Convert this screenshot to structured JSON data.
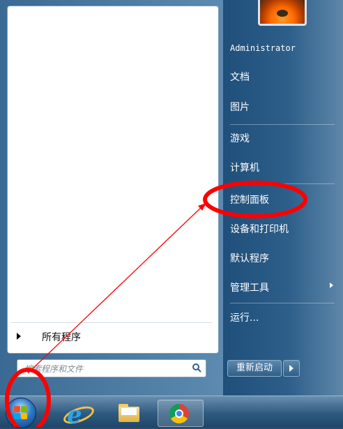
{
  "user": {
    "name": "Administrator"
  },
  "right_menu": {
    "documents": "文档",
    "pictures": "图片",
    "games": "游戏",
    "computer": "计算机",
    "control_panel": "控制面板",
    "devices_printers": "设备和打印机",
    "default_programs": "默认程序",
    "admin_tools": "管理工具",
    "run": "运行..."
  },
  "left_menu": {
    "all_programs": "所有程序",
    "search_placeholder": "搜索程序和文件"
  },
  "power": {
    "restart": "重新启动"
  },
  "taskbar": {
    "items": [
      "start-orb",
      "internet-explorer",
      "file-explorer",
      "chrome"
    ]
  },
  "annotation": {
    "color": "#ff0000"
  }
}
